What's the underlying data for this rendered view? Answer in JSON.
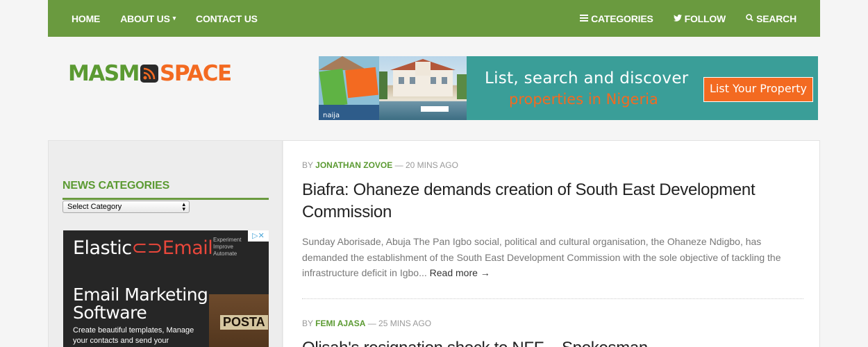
{
  "nav": {
    "left": [
      {
        "label": "HOME"
      },
      {
        "label": "ABOUT US",
        "caret": "▾"
      },
      {
        "label": "CONTACT US"
      }
    ],
    "right": [
      {
        "label": "CATEGORIES",
        "icon": "list-icon"
      },
      {
        "label": "FOLLOW",
        "icon": "twitter-icon"
      },
      {
        "label": "SEARCH",
        "icon": "search-icon"
      }
    ]
  },
  "logo": {
    "part1": "MASM",
    "part2": "SPACE"
  },
  "banner": {
    "brand": "naija",
    "line1": "List, search and discover",
    "line2": "properties in Nigeria",
    "button": "List Your Property"
  },
  "sidebar": {
    "title": "NEWS CATEGORIES",
    "select_value": "Select Category",
    "ad": {
      "logo_a": "Elastic",
      "logo_b": "Email",
      "tagline": [
        "Experiment",
        "Improve",
        "Automate"
      ],
      "headline_1": "Email Marketing",
      "headline_2": "Software",
      "body": "Create beautiful templates, Manage your contacts and send your",
      "sign": "POSTA"
    }
  },
  "articles": [
    {
      "by": "BY",
      "author": "JONATHAN ZOVOE",
      "time": "— 20 MINS AGO",
      "title": "Biafra: Ohaneze demands creation of South East Development Commission",
      "excerpt": "Sunday Aborisade, Abuja The Pan Igbo social, political and cultural organisation, the Ohaneze Ndigbo, has demanded the establishment of the South East Development Commission with the sole objective of tackling the infrastructure deficit in Igbo...",
      "more": "Read more →"
    },
    {
      "by": "BY",
      "author": "FEMI AJASA",
      "time": "— 25 MINS AGO",
      "title": "Olisah's resignation shock to NFF – Spokesman"
    }
  ],
  "colors": {
    "nav_bg": "#6a9a3f",
    "accent_green": "#5b9a32",
    "accent_orange": "#f36a21",
    "banner_bg": "#3a9e98"
  }
}
